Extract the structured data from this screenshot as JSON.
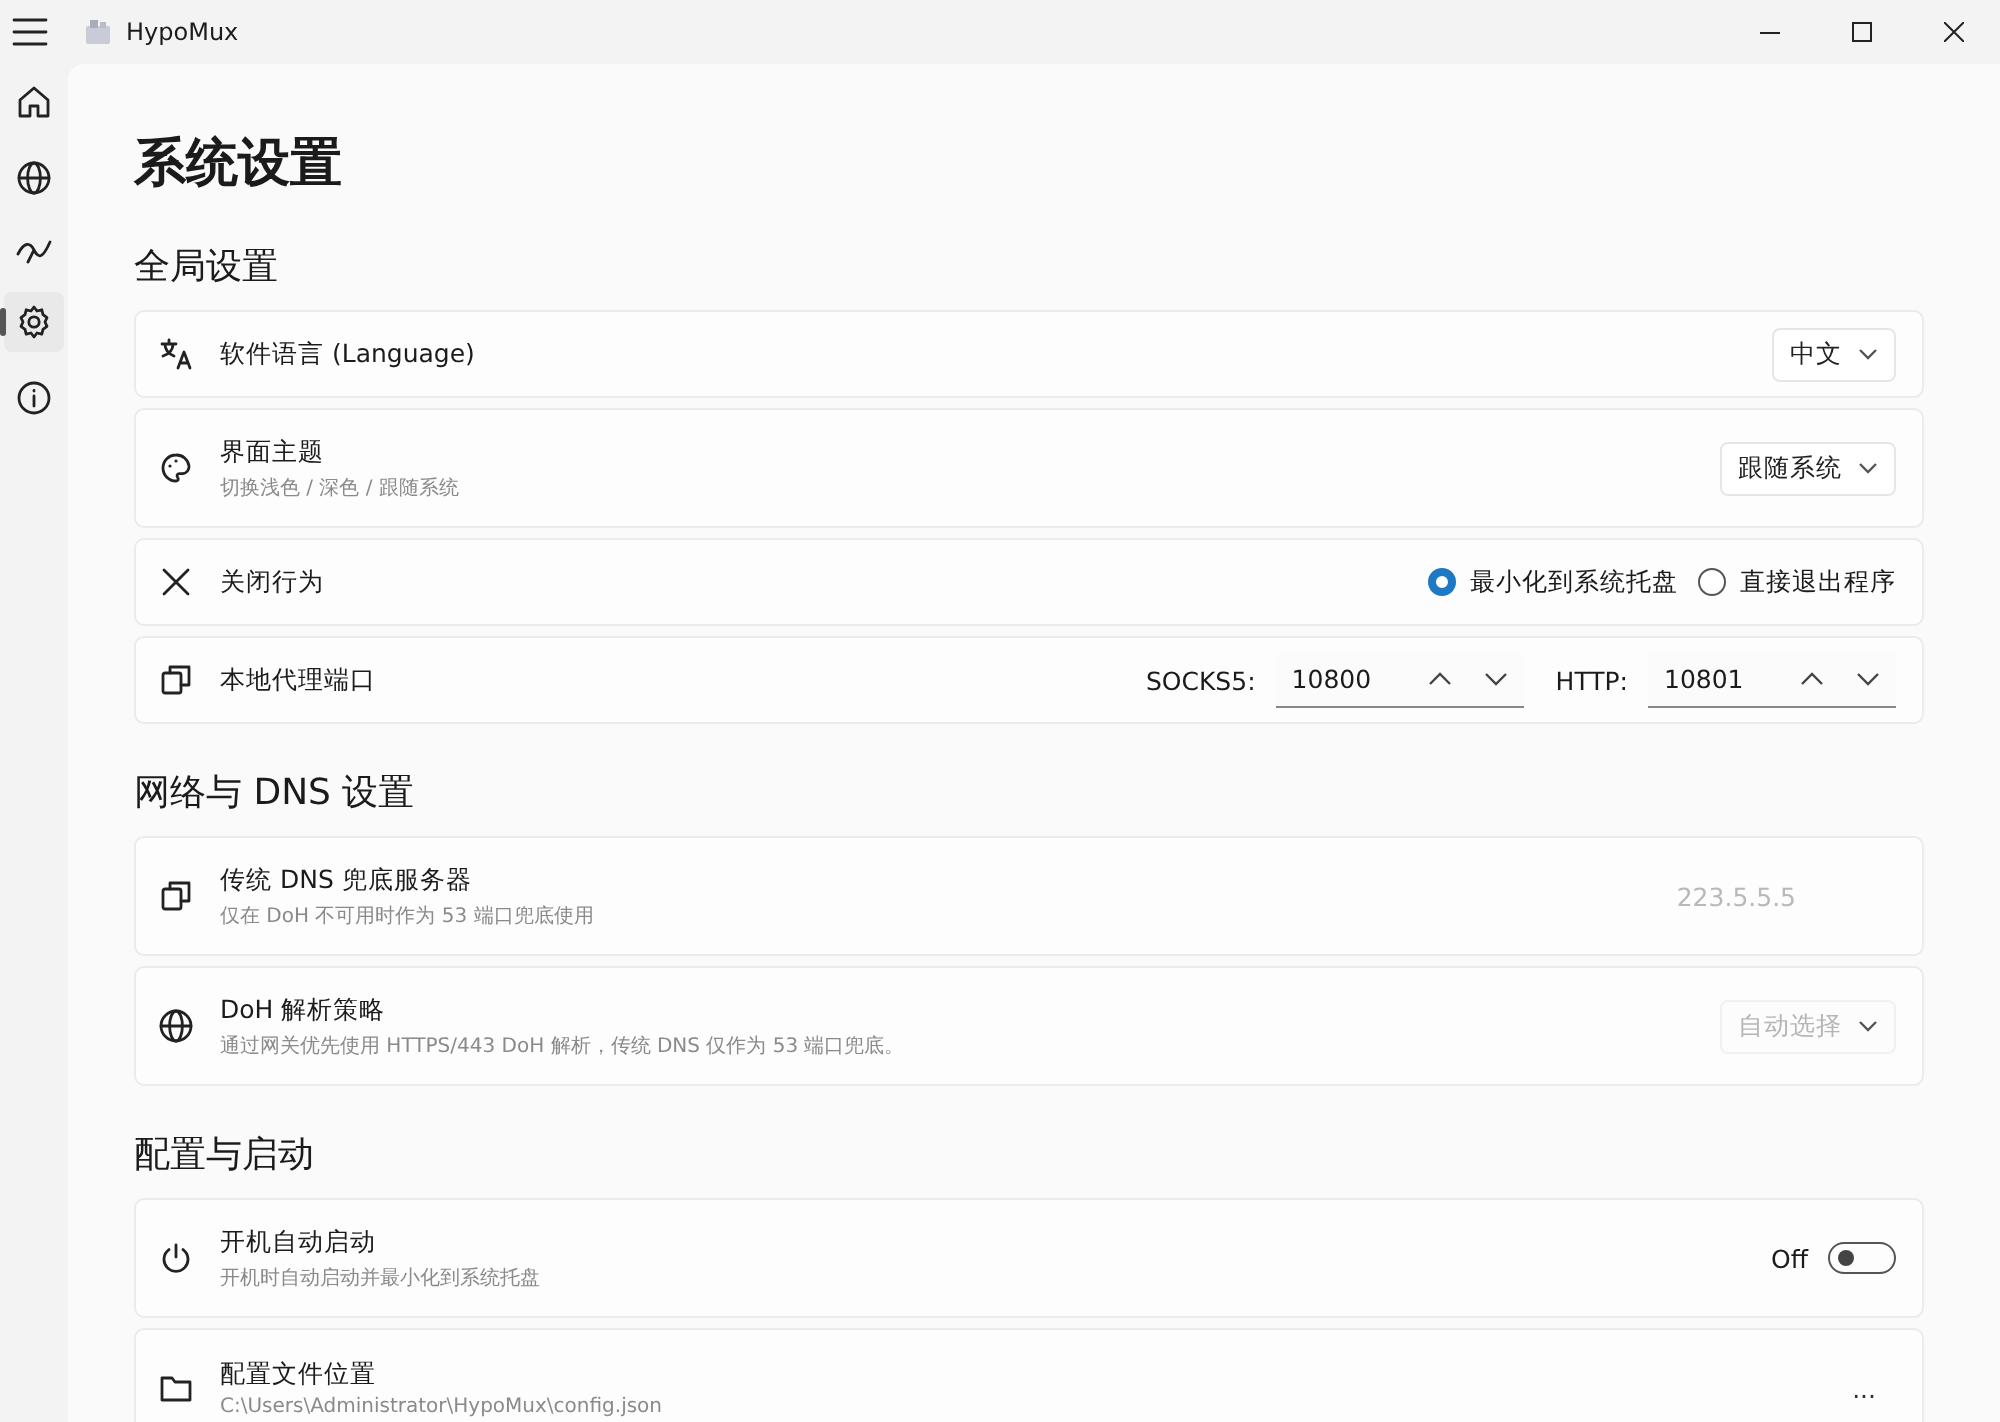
{
  "window": {
    "title": "HypoMux"
  },
  "nav": [
    {
      "selected": false
    },
    {
      "selected": false
    },
    {
      "selected": false
    },
    {
      "selected": true
    },
    {
      "selected": false
    }
  ],
  "page_title": "系统设置",
  "sections": [
    {
      "title": "全局设置",
      "rows": [
        {
          "kind": "dropdown",
          "title": "软件语言 (Language)",
          "value": "中文",
          "disabled": false
        },
        {
          "kind": "dropdown",
          "title": "界面主题",
          "description": "切换浅色 / 深色 / 跟随系统",
          "value": "跟随系统",
          "disabled": false
        },
        {
          "kind": "radio",
          "title": "关闭行为",
          "options": [
            {
              "label": "最小化到系统托盘",
              "selected": true
            },
            {
              "label": "直接退出程序",
              "selected": false
            }
          ]
        },
        {
          "kind": "ports",
          "title": "本地代理端口",
          "ports": [
            {
              "label": "SOCKS5:",
              "value": "10800"
            },
            {
              "label": "HTTP:",
              "value": "10801"
            }
          ]
        }
      ]
    },
    {
      "title": "网络与 DNS 设置",
      "rows": [
        {
          "kind": "text",
          "title": "传统 DNS 兜底服务器",
          "description": "仅在 DoH 不可用时作为 53 端口兜底使用",
          "value": "223.5.5.5",
          "disabled": true
        },
        {
          "kind": "dropdown",
          "title": "DoH 解析策略",
          "description": "通过网关优先使用 HTTPS/443 DoH 解析，传统 DNS 仅作为 53 端口兜底。",
          "value": "自动选择",
          "disabled": true
        }
      ]
    },
    {
      "title": "配置与启动",
      "rows": [
        {
          "kind": "toggle",
          "title": "开机自动启动",
          "description": "开机时自动启动并最小化到系统托盘",
          "state_label": "Off",
          "on": false
        },
        {
          "kind": "more",
          "title": "配置文件位置",
          "description": "C:\\Users\\Administrator\\HypoMux\\config.json",
          "more": "..."
        }
      ]
    }
  ]
}
